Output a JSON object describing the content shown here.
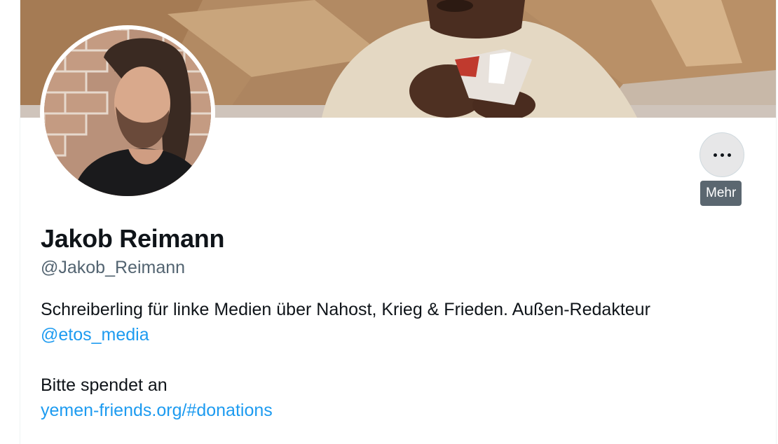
{
  "profile": {
    "display_name": "Jakob Reimann",
    "handle": "@Jakob_Reimann",
    "bio_line1": "Schreiberling für linke Medien über Nahost, Krieg & Frieden. Außen-Redakteur",
    "bio_mention": "@etos_media",
    "bio_line3": "Bitte spendet an",
    "bio_link": "yemen-friends.org/#donations"
  },
  "actions": {
    "more_tooltip": "Mehr"
  },
  "colors": {
    "link": "#1d9bf0",
    "text": "#0f1419",
    "muted": "#536471"
  },
  "icons": {
    "more": "more-horizontal-icon"
  }
}
